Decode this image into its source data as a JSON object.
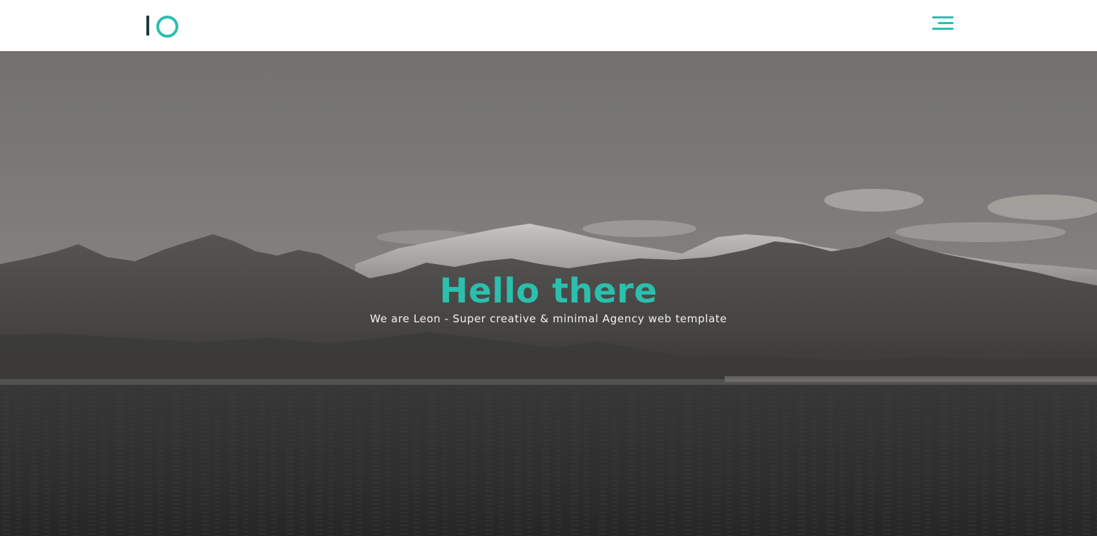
{
  "navbar": {
    "logo_icon": "io-logo",
    "menu_icon": "hamburger-menu-icon"
  },
  "hero": {
    "title": "Hello there",
    "subtitle": "We are Leon - Super creative & minimal Agency web template",
    "background": "mountain-sea-landscape"
  },
  "colors": {
    "accent": "#2bbfae",
    "logo_dark": "#1d3a45",
    "navbar_bg": "#ffffff",
    "subtitle_text": "#f2f2f2"
  }
}
